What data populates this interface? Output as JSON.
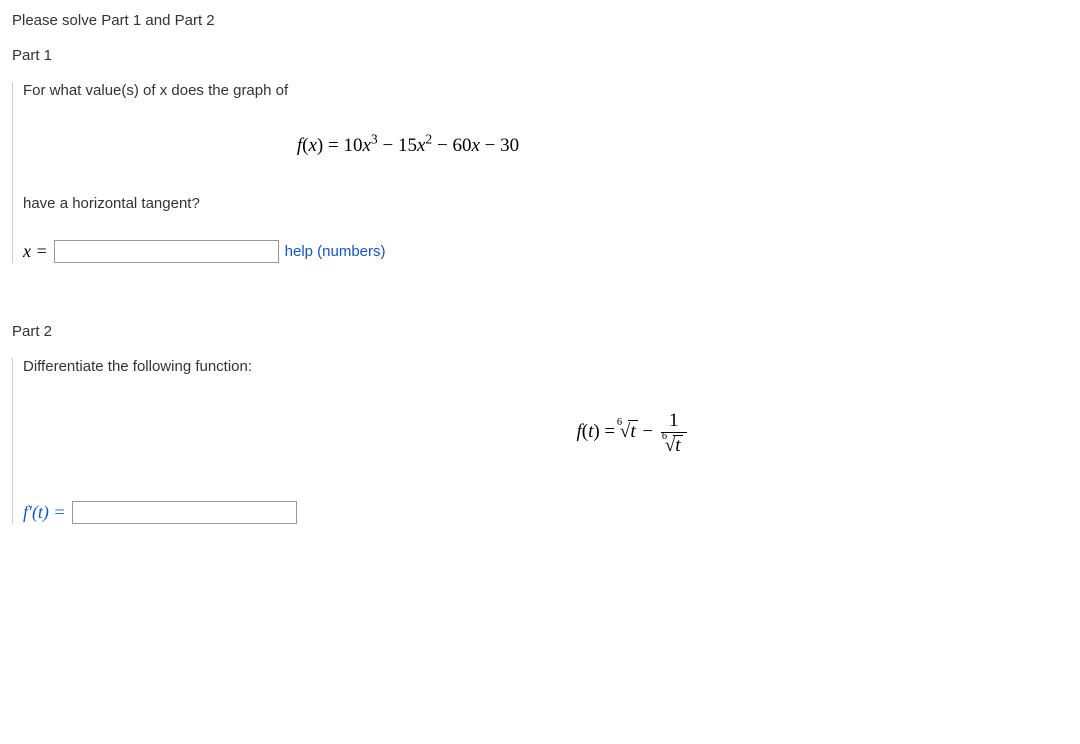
{
  "heading": "Please solve Part 1 and Part 2",
  "part1": {
    "title": "Part 1",
    "question_lead": "For what value(s) of x does the graph of",
    "equation_html": "<span class='math'><span class='it'>f</span><span class='rm'>(</span><span class='it'>x</span><span class='rm'>) = 10</span><span class='it'>x</span><sup>3</sup> <span class='rm'>&minus; 15</span><span class='it'>x</span><sup>2</sup> <span class='rm'>&minus; 60</span><span class='it'>x</span> <span class='rm'>&minus; 30</span></span>",
    "question_tail": "have a horizontal tangent?",
    "input_label": "x =",
    "help_text": "help (numbers)"
  },
  "part2": {
    "title": "Part 2",
    "question": "Differentiate the following function:",
    "equation_html": "<span class='math'><span class='it'>f</span><span class='rm'>(</span><span class='it'>t</span><span class='rm'>) = </span><span class='root'><span class='degree'>6</span><span class='radical'>&radic;</span><span class='radicand'>t</span></span> <span class='rm'>&minus;</span> <span class='frac'><span class='num'>1</span><span class='den'><span class='root'><span class='degree'>6</span><span class='radical'>&radic;</span><span class='radicand'>t</span></span></span></span></span>",
    "input_label": "f&prime;(t) ="
  }
}
